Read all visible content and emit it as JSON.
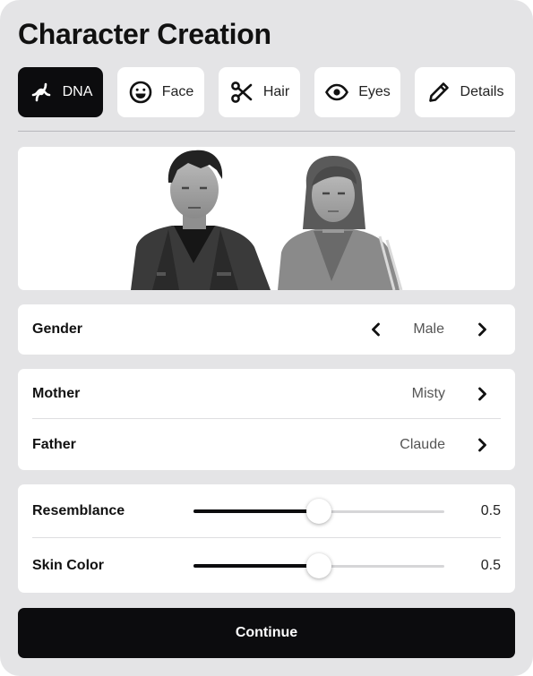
{
  "title": "Character Creation",
  "tabs": [
    {
      "label": "DNA",
      "icon": "dna-icon",
      "active": true
    },
    {
      "label": "Face",
      "icon": "smiley-face-icon",
      "active": false
    },
    {
      "label": "Hair",
      "icon": "scissors-icon",
      "active": false
    },
    {
      "label": "Eyes",
      "icon": "eye-icon",
      "active": false
    },
    {
      "label": "Details",
      "icon": "pencil-icon",
      "active": false
    }
  ],
  "preview": {
    "characters": [
      "male-character-portrait",
      "female-character-portrait"
    ]
  },
  "gender": {
    "label": "Gender",
    "value": "Male"
  },
  "parents": {
    "mother": {
      "label": "Mother",
      "value": "Misty"
    },
    "father": {
      "label": "Father",
      "value": "Claude"
    }
  },
  "sliders": {
    "resemblance": {
      "label": "Resemblance",
      "value": 0.5,
      "display": "0.5"
    },
    "skin_color": {
      "label": "Skin Color",
      "value": 0.5,
      "display": "0.5"
    }
  },
  "continue_label": "Continue",
  "colors": {
    "panel": "#e4e4e6",
    "active_tab": "#0c0c0e",
    "card": "#ffffff",
    "button": "#0c0c0e"
  }
}
